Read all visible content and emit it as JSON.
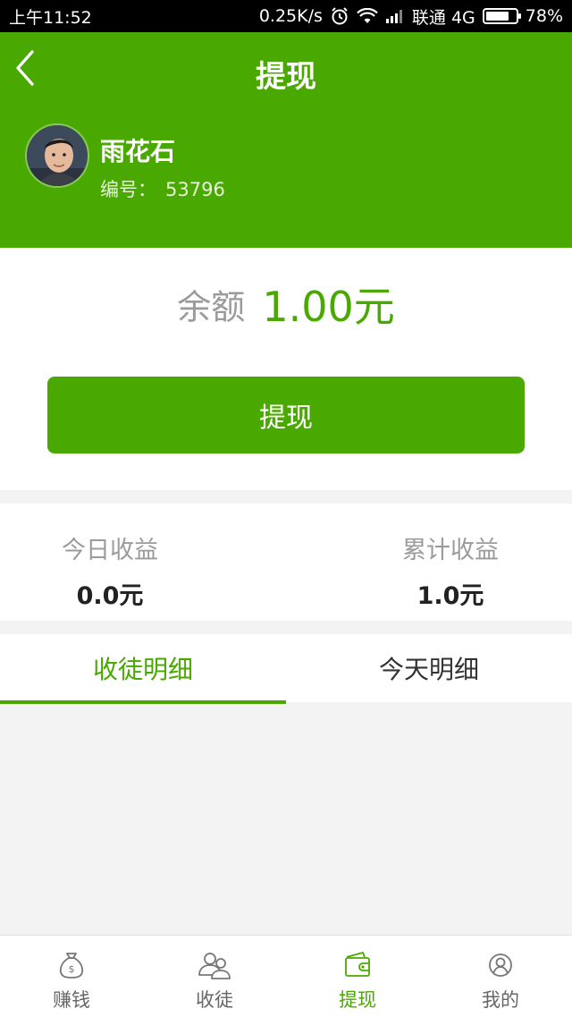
{
  "status_bar": {
    "time": "上午11:52",
    "speed": "0.25K/s",
    "carrier": "联通 4G",
    "battery": "78%",
    "battery_level": 0.78
  },
  "header": {
    "title": "提现",
    "back_icon": "chevron-left-icon"
  },
  "user": {
    "name": "雨花石",
    "id_label": "编号：",
    "id_value": "53796"
  },
  "balance": {
    "label": "余额",
    "value": "1.00元"
  },
  "withdraw_button": "提现",
  "stats": {
    "today_label": "今日收益",
    "today_value": "0.0元",
    "total_label": "累计收益",
    "total_value": "1.0元"
  },
  "tabs": [
    {
      "label": "收徒明细",
      "active": true
    },
    {
      "label": "今天明细",
      "active": false
    }
  ],
  "bottom_nav": [
    {
      "label": "赚钱",
      "icon": "money-bag-icon",
      "active": false
    },
    {
      "label": "收徒",
      "icon": "users-icon",
      "active": false
    },
    {
      "label": "提现",
      "icon": "wallet-icon",
      "active": true
    },
    {
      "label": "我的",
      "icon": "user-circle-icon",
      "active": false
    }
  ],
  "colors": {
    "accent": "#49a900",
    "muted_text": "#9b9b9b",
    "background": "#f3f3f3"
  }
}
